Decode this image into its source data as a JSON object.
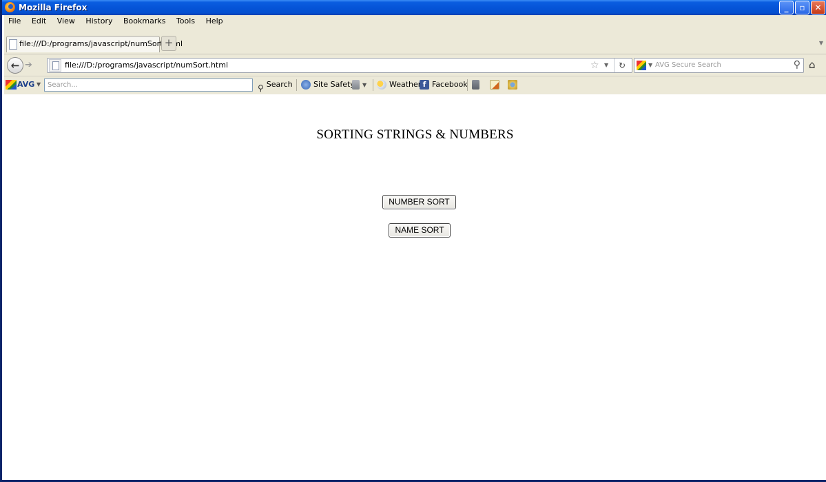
{
  "window": {
    "title": "Mozilla Firefox",
    "buttons": {
      "minimize": "_",
      "maximize": "▫",
      "close": "X"
    }
  },
  "menu": [
    "File",
    "Edit",
    "View",
    "History",
    "Bookmarks",
    "Tools",
    "Help"
  ],
  "tabs": [
    {
      "label": "file:///D:/programs/javascript/numSort.html"
    }
  ],
  "new_tab_label": "+",
  "nav": {
    "url": "file:///D:/programs/javascript/numSort.html",
    "search_placeholder": "AVG Secure Search"
  },
  "avg_toolbar": {
    "brand": "AVG",
    "search_placeholder": "Search...",
    "search_button": "Search",
    "site_safety": "Site Safety",
    "weather": "Weather",
    "facebook": "Facebook"
  },
  "page": {
    "heading": "SORTING STRINGS & NUMBERS",
    "number_sort_button": "NUMBER SORT",
    "name_sort_button": "NAME SORT"
  },
  "colors": {
    "titlebar": "#0554d8",
    "chrome": "#ece9d8",
    "window_border": "#0a246a"
  }
}
